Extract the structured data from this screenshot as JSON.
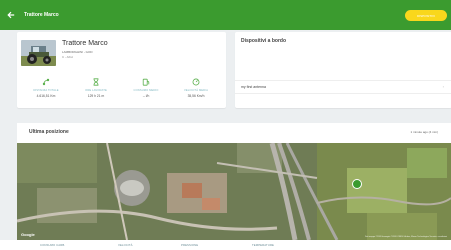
{
  "appbar": {
    "title": "Trattore Marco",
    "action_label": "DISPOSITIVI"
  },
  "vehicle": {
    "name": "Trattore Marco",
    "model": "LAMBORGHINI - GOD",
    "plate": "C - AKH",
    "stats": [
      {
        "icon": "route-icon",
        "label": "DISTANZA TOTALE",
        "value": "4.616,51 Km"
      },
      {
        "icon": "hourglass-icon",
        "label": "ORE LAVORATE",
        "value": "129 h 21 m"
      },
      {
        "icon": "fuel-icon",
        "label": "CONSUMO MEDIO",
        "value": "-- l/h"
      },
      {
        "icon": "speedometer-icon",
        "label": "VELOCITÀ MEDIA",
        "value": "35,56 Km/h"
      }
    ]
  },
  "devices": {
    "title": "Dispositivi a bordo",
    "items": [
      {
        "name": "my first antenna"
      }
    ]
  },
  "position": {
    "title": "Ultima posizione",
    "time": "1 minute ago (4 min)"
  },
  "map": {
    "google_label": "Google",
    "attribution": "Dati mappa ©2020 Immagini ©2020 CNES / Airbus, Maxar Technologies  Termini e condizioni"
  },
  "bottom_tabs": [
    "CONSUMO CARB.",
    "VELOCITÀ",
    "PRESSIONE",
    "TEMPERATURE"
  ],
  "colors": {
    "primary": "#3b9b2f",
    "accent": "#f9d71c",
    "icon_green": "#5bb04d",
    "label_teal": "#81b8c2"
  }
}
